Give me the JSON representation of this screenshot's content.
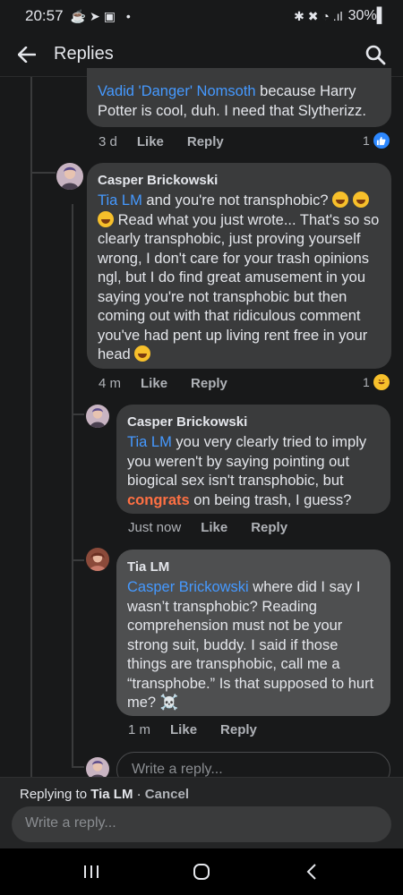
{
  "status": {
    "time": "20:57",
    "left_icons": "☕➤▣ •",
    "right_icons": "✱ ✖ ◔ .ıl",
    "battery": "30%▌"
  },
  "header": {
    "title": "Replies"
  },
  "comments": [
    {
      "mention": "Vadid 'Danger' Nomsoth",
      "text": " because Harry Potter is cool, duh. I need that Slytherizz.",
      "time": "3 d",
      "like": "Like",
      "reply": "Reply",
      "reaction_count": "1",
      "reaction": "like"
    },
    {
      "author": "Casper Brickowski",
      "mention": "Tia LM",
      "text1": " and you're not transphobic? ",
      "text2": " Read what you just wrote... That's so so clearly transphobic, just proving yourself wrong, I don't care for your trash opinions ngl, but I do find great amusement in you saying you're not transphobic but then coming out with that ridiculous comment you've had pent up living rent free in your head ",
      "time": "4 m",
      "like": "Like",
      "reply": "Reply",
      "reaction_count": "1",
      "reaction": "haha"
    },
    {
      "author": "Casper Brickowski",
      "mention": "Tia LM",
      "text1": " you very clearly tried to imply you weren't by saying pointing out biogical sex isn't transphobic, but ",
      "highlight": "congrats",
      "text2": " on being trash, I guess?",
      "time": "Just now",
      "like": "Like",
      "reply": "Reply"
    },
    {
      "author": "Tia LM",
      "mention": "Casper Brickowski",
      "text": " where did I say I wasn’t transphobic? Reading comprehension must not be your strong suit, buddy. I said if those things are transphobic, call me a “transphobe.” Is that supposed to hurt me? ☠️",
      "time": "1 m",
      "like": "Like",
      "reply": "Reply"
    }
  ],
  "inline_reply_placeholder": "Write a reply...",
  "replying": {
    "prefix": "Replying to ",
    "name": "Tia LM",
    "sep": " · ",
    "cancel": "Cancel"
  },
  "composer_placeholder": "Write a reply...",
  "colors": {
    "background": "#18191a",
    "bubble": "#3a3b3c",
    "mention": "#4599ff",
    "like_blue": "#2d88ff"
  }
}
